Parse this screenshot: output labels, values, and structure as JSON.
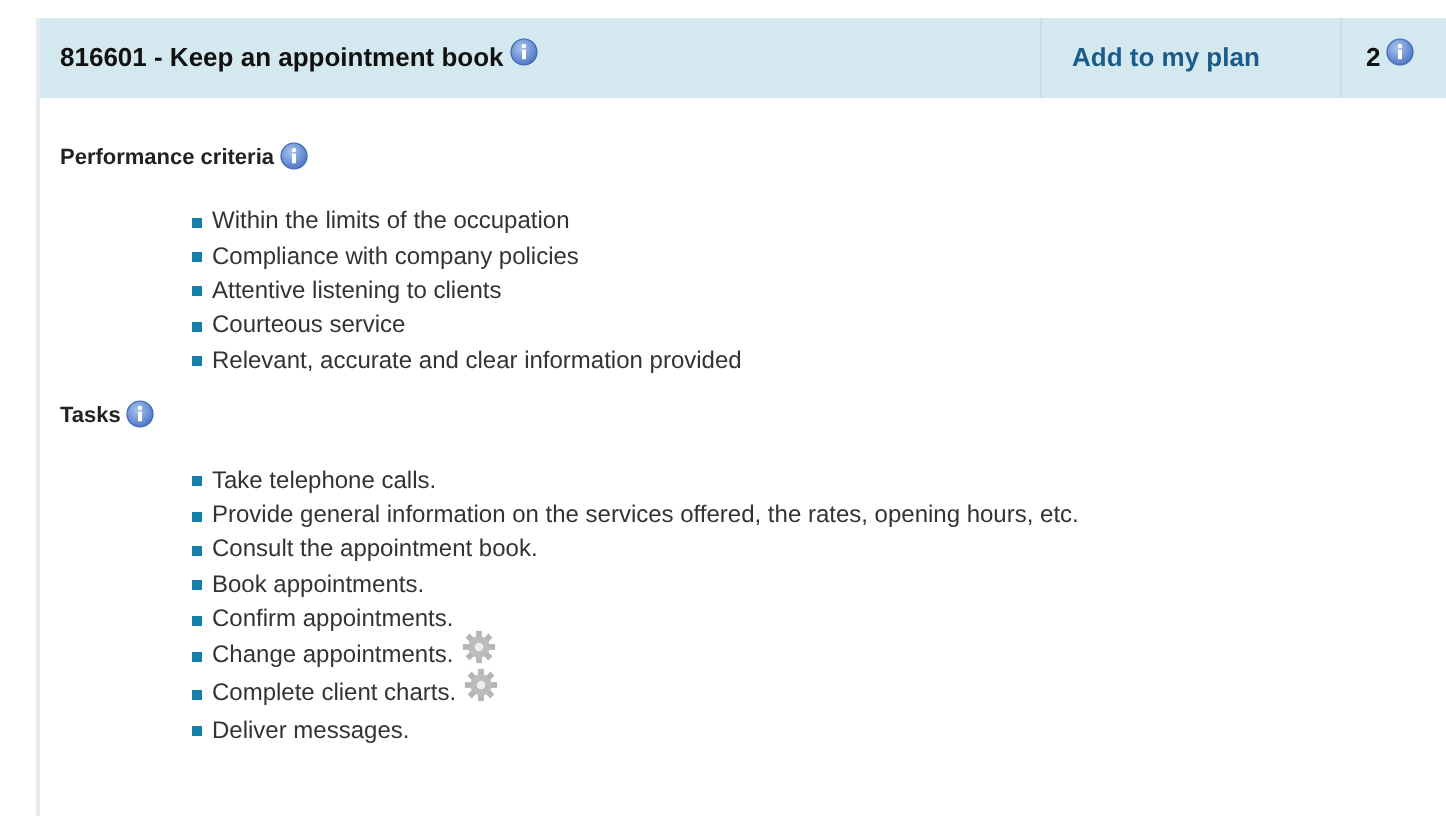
{
  "header": {
    "title": "816601 - Keep an appointment book",
    "action": "Add to my plan",
    "count": "2"
  },
  "sections": [
    {
      "heading": "Performance criteria",
      "items": [
        {
          "text": "Within the limits of the occupation",
          "gear": false
        },
        {
          "text": "Compliance with company policies",
          "gear": false
        },
        {
          "text": "Attentive listening to clients",
          "gear": false
        },
        {
          "text": "Courteous service",
          "gear": false
        },
        {
          "text": "Relevant, accurate and clear information provided",
          "gear": false
        }
      ]
    },
    {
      "heading": "Tasks",
      "items": [
        {
          "text": "Take telephone calls.",
          "gear": false
        },
        {
          "text": "Provide general information on the services offered, the rates, opening hours, etc.",
          "gear": false
        },
        {
          "text": "Consult the appointment book.",
          "gear": false
        },
        {
          "text": "Book appointments.",
          "gear": false
        },
        {
          "text": "Confirm appointments.",
          "gear": false
        },
        {
          "text": "Change appointments.",
          "gear": true
        },
        {
          "text": "Complete client charts.",
          "gear": true
        },
        {
          "text": "Deliver messages.",
          "gear": false
        }
      ]
    }
  ]
}
